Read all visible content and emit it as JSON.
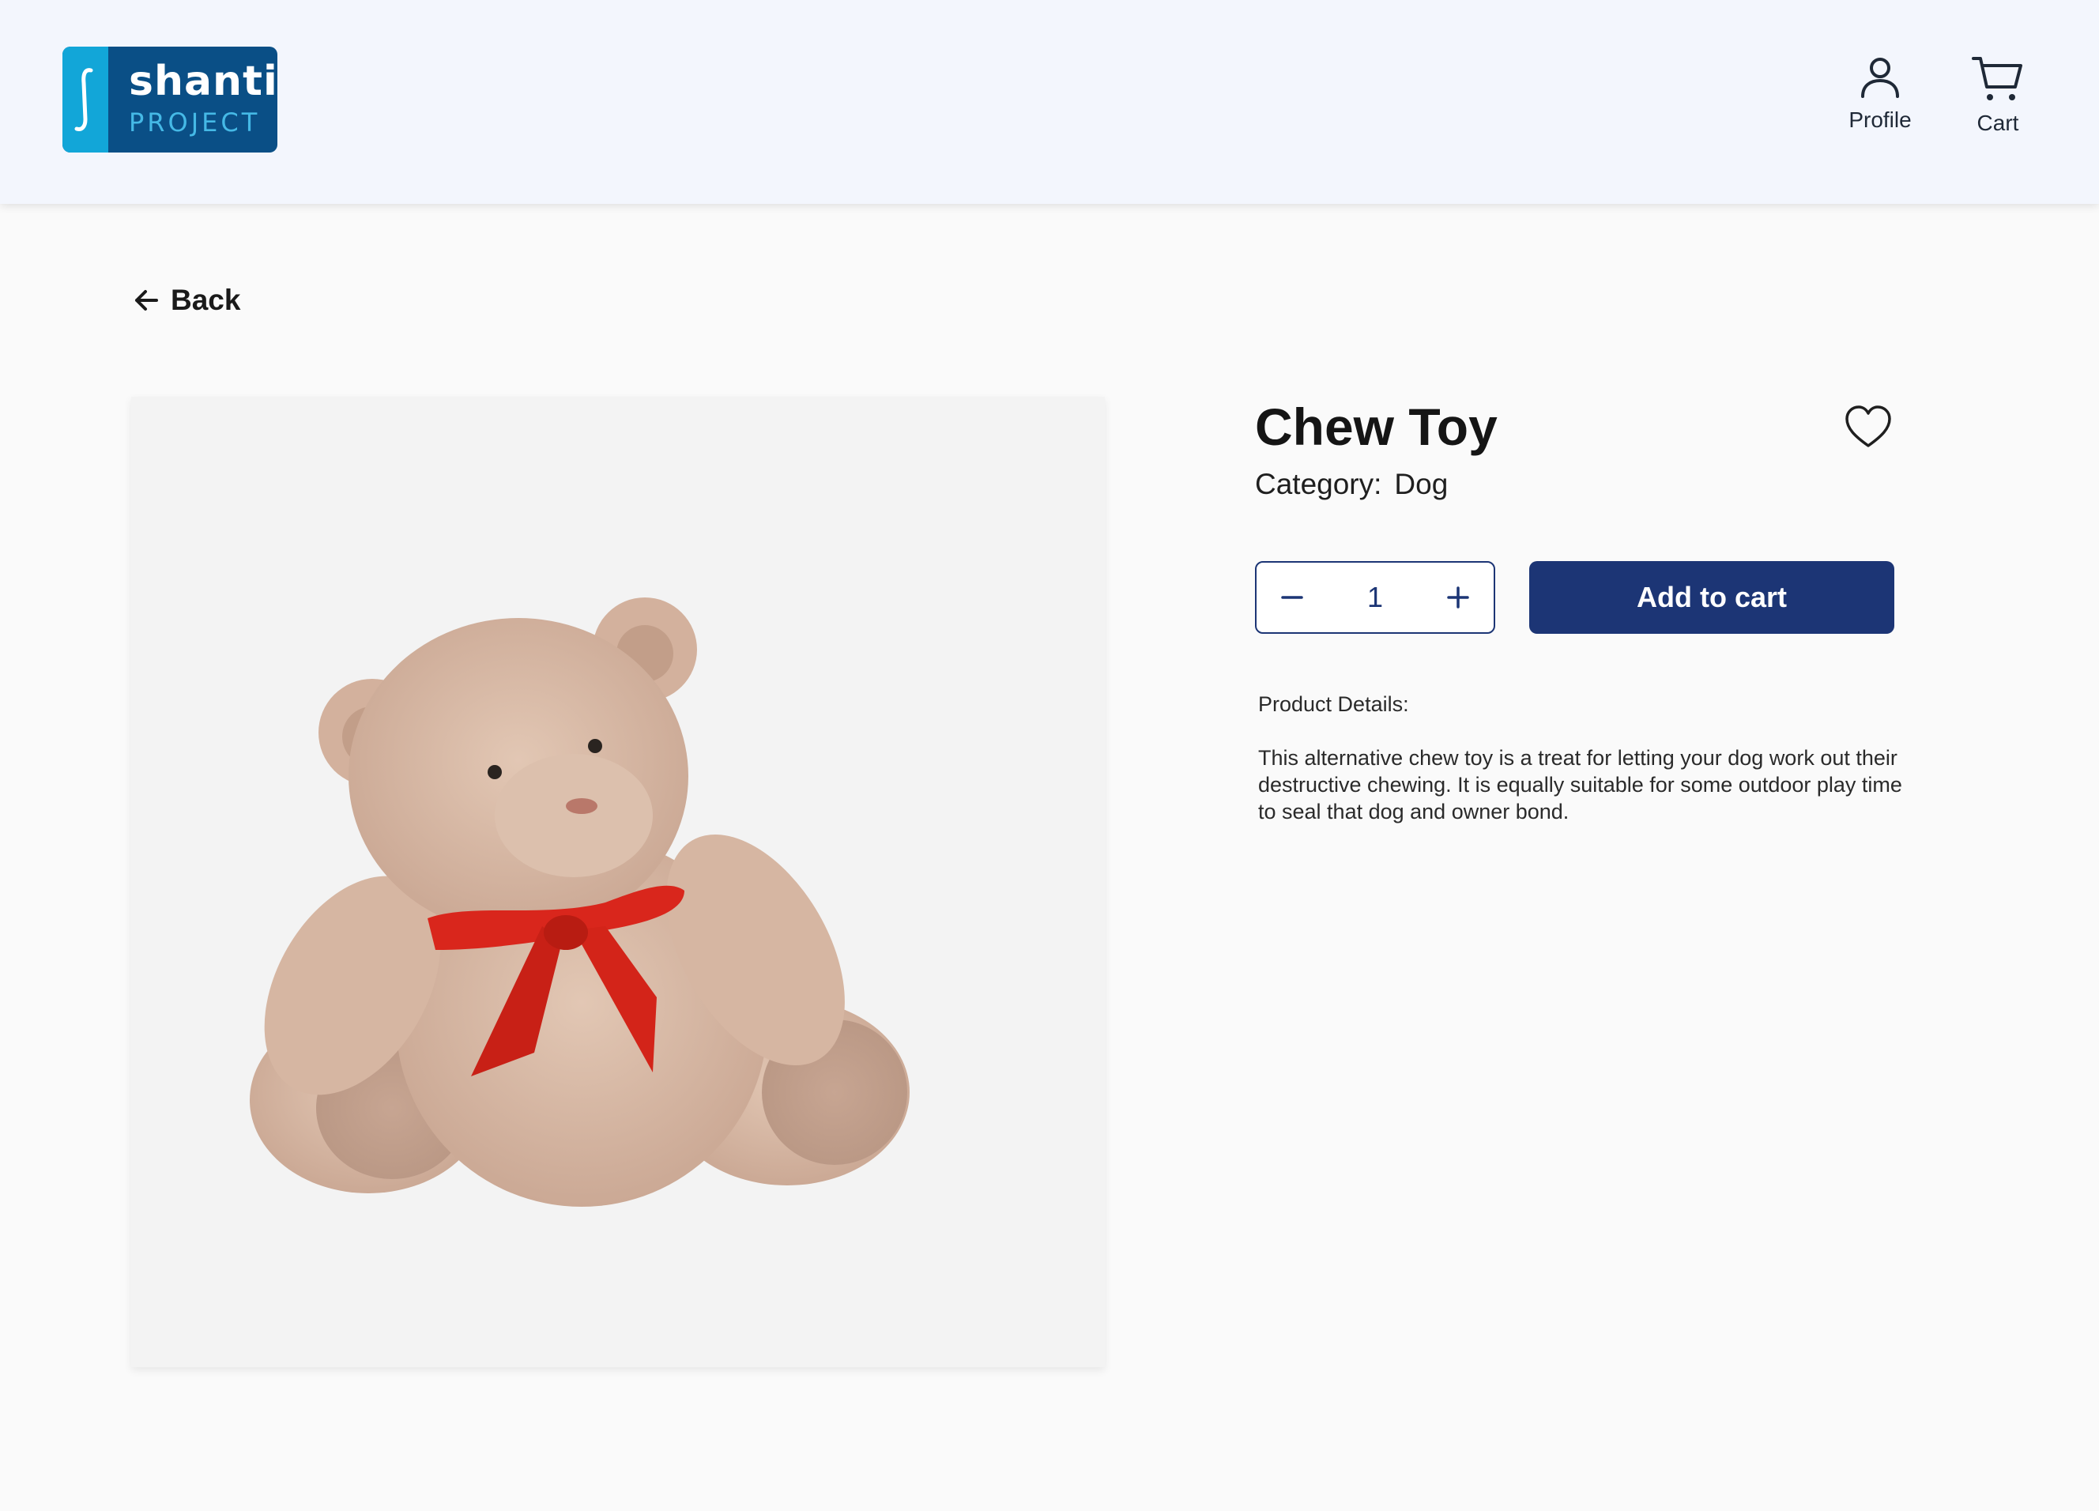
{
  "header": {
    "logo": {
      "word": "shanti",
      "sub": "PROJECT",
      "icon": "logo-mark"
    },
    "nav": [
      {
        "label": "Profile",
        "icon": "user-icon"
      },
      {
        "label": "Cart",
        "icon": "cart-icon"
      }
    ]
  },
  "back": {
    "label": "Back",
    "icon": "arrow-left-icon"
  },
  "product": {
    "image": "teddy-bear-with-red-bow",
    "title": "Chew Toy",
    "category_label": "Category:",
    "category_value": "Dog",
    "favorite_icon": "heart-outline-icon",
    "quantity": {
      "value": "1",
      "minus_icon": "minus-icon",
      "plus_icon": "plus-icon"
    },
    "add_to_cart_label": "Add to cart",
    "details_label": "Product Details:",
    "details_text": "This alternative chew toy is a treat for letting your dog work out their destructive chewing. It is equally suitable for some outdoor play time to seal that dog and owner bond."
  },
  "colors": {
    "header_bg": "#f3f6fd",
    "page_bg": "#fafafa",
    "primary": "#1c3575",
    "logo_dark": "#0a4f86",
    "logo_light": "#12a6d8",
    "bow_red": "#d9261c",
    "plush": "#d8b8a4"
  }
}
